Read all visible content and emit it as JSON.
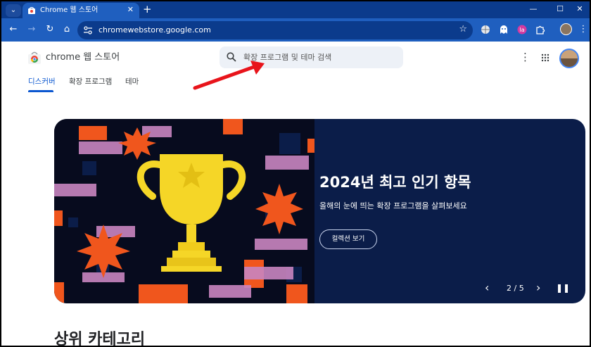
{
  "browser": {
    "tab": {
      "title": "Chrome 웹 스토어"
    },
    "url": "chromewebstore.google.com"
  },
  "store": {
    "name": "chrome 웹 스토어",
    "search_placeholder": "확장 프로그램 및 테마 검색",
    "nav_tabs": [
      "디스커버",
      "확장 프로그램",
      "테마"
    ],
    "active_tab": "디스커버"
  },
  "hero": {
    "title": "2024년 최고 인기 항목",
    "subtitle": "올해의 눈에 띄는 확장 프로그램을 살펴보세요",
    "button": "컬렉션 보기",
    "counter": "2 / 5"
  },
  "section": {
    "title": "상위 카테고리"
  },
  "colors": {
    "tabstrip": "#0b3b8c",
    "toolbar": "#1f5fbf",
    "hero_bg": "#0b1d49",
    "accent": "#0b57d0",
    "orange": "#f0561d",
    "trophy": "#f5d627"
  }
}
